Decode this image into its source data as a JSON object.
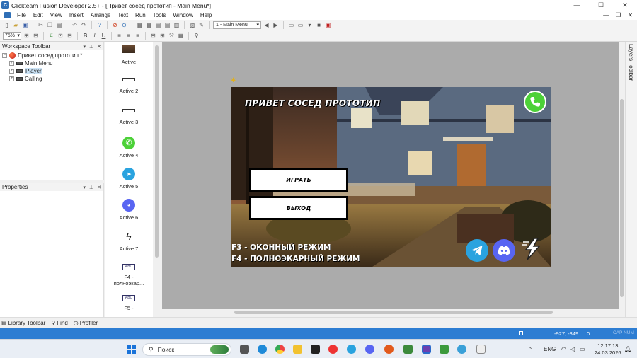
{
  "window": {
    "title": "Clickteam Fusion Developer 2.5+ - [Привет сосед прототип - Main Menu*]",
    "app_icon": "clickteam-icon",
    "controls": [
      "minimize-icon",
      "maximize-icon",
      "close-icon"
    ]
  },
  "menu": {
    "items": [
      "File",
      "Edit",
      "View",
      "Insert",
      "Arrange",
      "Text",
      "Run",
      "Tools",
      "Window",
      "Help"
    ]
  },
  "toolbar": {
    "frame_select": "1 - Main Menu",
    "zoom": "75%",
    "zoom_search_glyph": "⚲"
  },
  "workspace": {
    "header": "Workspace Toolbar",
    "tree": [
      {
        "label": "Привет сосед прототип *",
        "level": 0,
        "type": "game"
      },
      {
        "label": "Main Menu",
        "level": 1,
        "type": "frame"
      },
      {
        "label": "Player",
        "level": 1,
        "type": "frame",
        "selected": true
      },
      {
        "label": "Calling",
        "level": 1,
        "type": "frame"
      }
    ]
  },
  "properties": {
    "header": "Properties"
  },
  "objects": [
    {
      "label": "Active",
      "icon": "house-thumbnail-icon"
    },
    {
      "label": "Active 2",
      "icon": "line-icon"
    },
    {
      "label": "Active 3",
      "icon": "line-icon"
    },
    {
      "label": "Active 4",
      "icon": "phone-icon"
    },
    {
      "label": "Active 5",
      "icon": "telegram-icon"
    },
    {
      "label": "Active 6",
      "icon": "discord-icon"
    },
    {
      "label": "Active 7",
      "icon": "lightning-icon"
    },
    {
      "label": "F4 - полноэкар...",
      "icon": "text-object-icon"
    },
    {
      "label": "F5 -",
      "icon": "text-object-icon"
    }
  ],
  "canvas": {
    "title": "ПРИВЕТ СОСЕД ПРОТОТИП",
    "play_button": "ИГРАТЬ",
    "exit_button": "ВЫХОД",
    "hint_f3": "F3 - ОКОННЫЙ РЕЖИМ",
    "hint_f4": "F4 - ПОЛНОЭКАРНЫЙ РЕЖИМ",
    "colors": {
      "phone": "#4cd138",
      "telegram": "#2aa3df",
      "discord": "#5865f2"
    }
  },
  "layers": {
    "label": "Layers Toolbar"
  },
  "bottom_tabs": {
    "library": "Library Toolbar",
    "find": "Find",
    "profiler": "Profiler"
  },
  "status": {
    "coords": "-927, -349",
    "zero": "0",
    "caps": "CAP NUM"
  },
  "taskbar": {
    "search_placeholder": "Поиск",
    "language": "ENG",
    "time": "12:17:13",
    "date": "24.03.2026"
  }
}
